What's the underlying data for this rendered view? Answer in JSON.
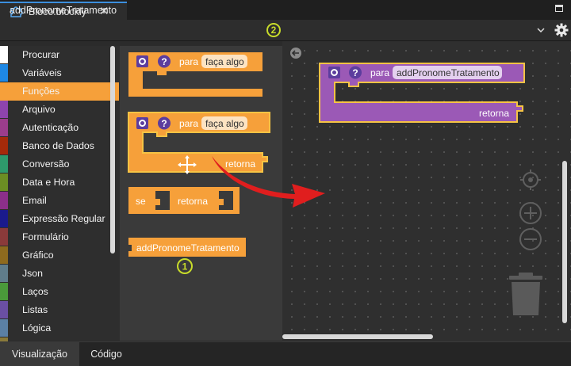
{
  "tab": {
    "label": "Bloco.blockly",
    "close": "✕"
  },
  "function_name": "addPronomeTratamento",
  "callouts": {
    "one": "1",
    "two": "2"
  },
  "categories": [
    {
      "label": "Procurar",
      "color": "#ffffff"
    },
    {
      "label": "Variáveis",
      "color": "#1e88e5"
    },
    {
      "label": "Funções",
      "color": "#f6a03a",
      "selected": true
    },
    {
      "label": "Arquivo",
      "color": "#8e44ad"
    },
    {
      "label": "Autenticação",
      "color": "#9b3d8c"
    },
    {
      "label": "Banco de Dados",
      "color": "#a52a0a"
    },
    {
      "label": "Conversão",
      "color": "#2e9a6b"
    },
    {
      "label": "Data e Hora",
      "color": "#6b8e23"
    },
    {
      "label": "Email",
      "color": "#8b2f8a"
    },
    {
      "label": "Expressão Regular",
      "color": "#1a1a8c"
    },
    {
      "label": "Formulário",
      "color": "#8b3a3a"
    },
    {
      "label": "Gráfico",
      "color": "#8e6a1e"
    },
    {
      "label": "Json",
      "color": "#607d8b"
    },
    {
      "label": "Laços",
      "color": "#4a9a3a"
    },
    {
      "label": "Listas",
      "color": "#6a4fa3"
    },
    {
      "label": "Lógica",
      "color": "#5b80a5"
    },
    {
      "label": "",
      "color": "#8a7a3a"
    }
  ],
  "flyout": {
    "block1": {
      "keyword": "para",
      "field": "faça algo"
    },
    "block2": {
      "keyword": "para",
      "field": "faça algo",
      "return_label": "retorna"
    },
    "block3": {
      "if_label": "se",
      "return_label": "retorna"
    },
    "block4": {
      "call_label": "addPronomeTratamento"
    }
  },
  "workspace_block": {
    "keyword": "para",
    "field": "addPronomeTratamento",
    "return_label": "retorna"
  },
  "bottom_tabs": {
    "visualizacao": "Visualização",
    "codigo": "Código"
  },
  "colors": {
    "function_orange": "#f6a03a",
    "function_purple": "#9b59b6",
    "highlight": "#f6c344",
    "callout": "#c8dc2a"
  }
}
